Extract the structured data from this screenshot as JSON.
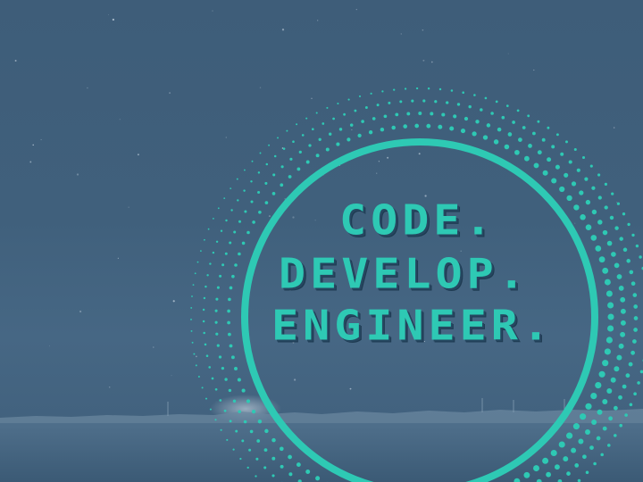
{
  "slogan": {
    "line1": "CODE.",
    "line2": "DEVELOP.",
    "line3": "ENGINEER."
  },
  "colors": {
    "background": "#3e5d79",
    "accent": "#2ec9b4",
    "text_shadow": "#264761",
    "horizon": "#5a7a96"
  }
}
